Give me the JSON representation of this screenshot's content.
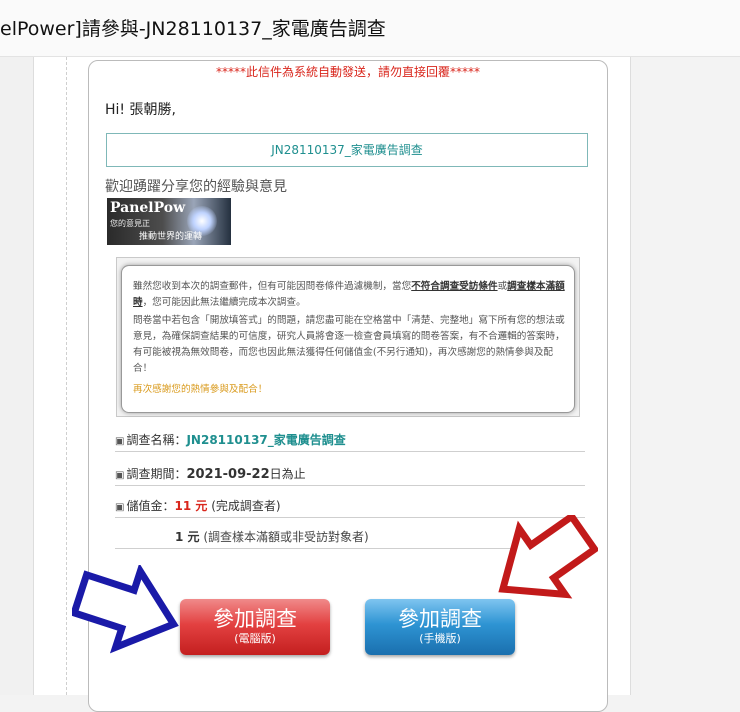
{
  "window": {
    "title": "elPower]請參與-JN28110137_家電廣告調查"
  },
  "mail": {
    "system_note": "*****此信件為系統自動發送，請勿直接回覆*****",
    "greeting": "Hi! 張朝勝,",
    "survey_box": "JN28110137_家電廣告調查",
    "welcome": "歡迎踴躍分享您的經驗與意見",
    "logo": {
      "brand": "PanelPow",
      "tag1": "您的意見正",
      "tag2": "推動世界的運轉"
    },
    "info": {
      "p1_a": "雖然您收到本次的調查郵件，但有可能因問卷條件過濾機制，當您",
      "p1_b": "不符合調查受訪條件",
      "p1_c": "或",
      "p1_d": "調查樣本滿額時",
      "p1_e": "，您可能因此無法繼續完成本次調查。",
      "p2": "問卷當中若包含「開放填答式」的問題，請您盡可能在空格當中「清楚、完整地」寫下所有您的想法或意見，為確保調查結果的可信度，研究人員將會逐一檢查會員填寫的問卷答案，有不合邏輯的答案時，有可能被視為無效問卷，而您也因此無法獲得任何儲值金(不另行通知)，再次感謝您的熱情參與及配合！",
      "p3": "再次感謝您的熱情參與及配合！"
    },
    "details": {
      "bullet": "▣",
      "name_label": "調查名稱：",
      "name_value": "JN28110137_家電廣告調查",
      "period_label": "調查期間：",
      "period_value": "2021-09-22",
      "period_suffix": "日為止",
      "reward_label": "儲值金：",
      "reward_value": "11 元",
      "reward_note": "(完成調查者)",
      "consolation_value": "1 元",
      "consolation_note": "(調查樣本滿額或非受訪對象者)"
    },
    "buttons": {
      "pc_main": "參加調查",
      "pc_sub": "(電腦版)",
      "mobile_main": "參加調查",
      "mobile_sub": "(手機版)"
    }
  },
  "colors": {
    "accent_red": "#d9261c",
    "accent_teal": "#1f8f8f",
    "arrow_blue": "#1a1aa8",
    "arrow_red": "#c21a1a"
  }
}
